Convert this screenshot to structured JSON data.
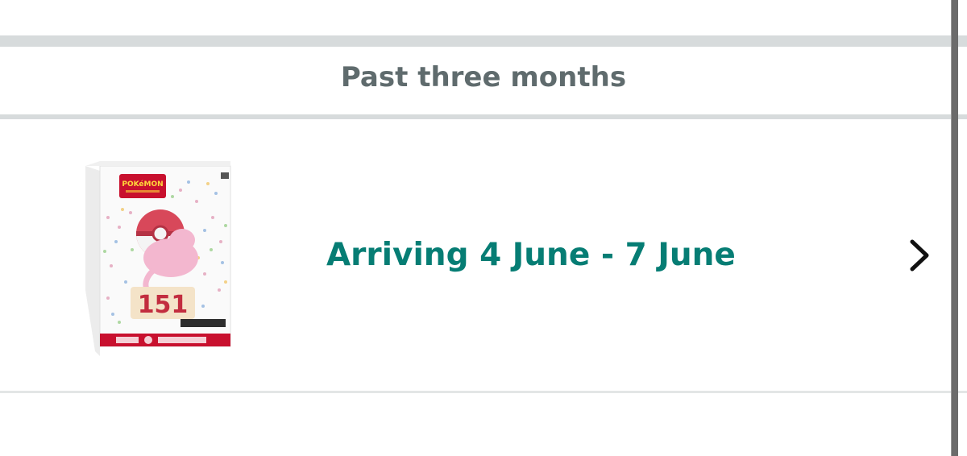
{
  "section": {
    "title": "Past three months"
  },
  "order": {
    "arrival": "Arriving 4 June - 7 June",
    "product_image": {
      "brand_text": "POKéMON",
      "set_text": "151",
      "description": "Pokémon 151 booster bundle box"
    },
    "chevron_icon": "chevron-right-icon"
  },
  "colors": {
    "arrival_text": "#067d74",
    "section_title": "#5f6b6d",
    "divider": "#d7dbdc"
  }
}
